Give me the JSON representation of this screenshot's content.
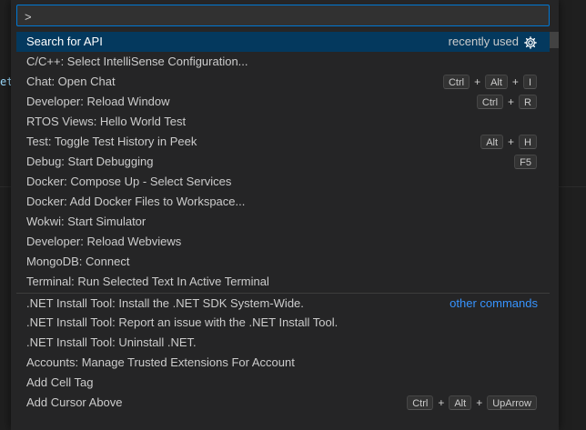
{
  "editor": {
    "snippet": "et_"
  },
  "palette": {
    "input_value": ">",
    "rows": [
      {
        "label": "Search for API",
        "meta": "recently used",
        "keys": []
      },
      {
        "label": "C/C++: Select IntelliSense Configuration...",
        "keys": []
      },
      {
        "label": "Chat: Open Chat",
        "keys": [
          "Ctrl",
          "Alt",
          "I"
        ]
      },
      {
        "label": "Developer: Reload Window",
        "keys": [
          "Ctrl",
          "R"
        ]
      },
      {
        "label": "RTOS Views: Hello World Test",
        "keys": []
      },
      {
        "label": "Test: Toggle Test History in Peek",
        "keys": [
          "Alt",
          "H"
        ]
      },
      {
        "label": "Debug: Start Debugging",
        "keys": [
          "F5"
        ]
      },
      {
        "label": "Docker: Compose Up - Select Services",
        "keys": []
      },
      {
        "label": "Docker: Add Docker Files to Workspace...",
        "keys": []
      },
      {
        "label": "Wokwi: Start Simulator",
        "keys": []
      },
      {
        "label": "Developer: Reload Webviews",
        "keys": []
      },
      {
        "label": "MongoDB: Connect",
        "keys": []
      },
      {
        "label": "Terminal: Run Selected Text In Active Terminal",
        "keys": []
      },
      {
        "label": ".NET Install Tool: Install the .NET SDK System-Wide.",
        "meta": "other commands",
        "keys": []
      },
      {
        "label": ".NET Install Tool: Report an issue with the .NET Install Tool.",
        "keys": []
      },
      {
        "label": ".NET Install Tool: Uninstall .NET.",
        "keys": []
      },
      {
        "label": "Accounts: Manage Trusted Extensions For Account",
        "keys": []
      },
      {
        "label": "Add Cell Tag",
        "keys": []
      },
      {
        "label": "Add Cursor Above",
        "keys": [
          "Ctrl",
          "Alt",
          "UpArrow"
        ]
      }
    ]
  },
  "icons": {
    "configure": "gear-icon"
  }
}
